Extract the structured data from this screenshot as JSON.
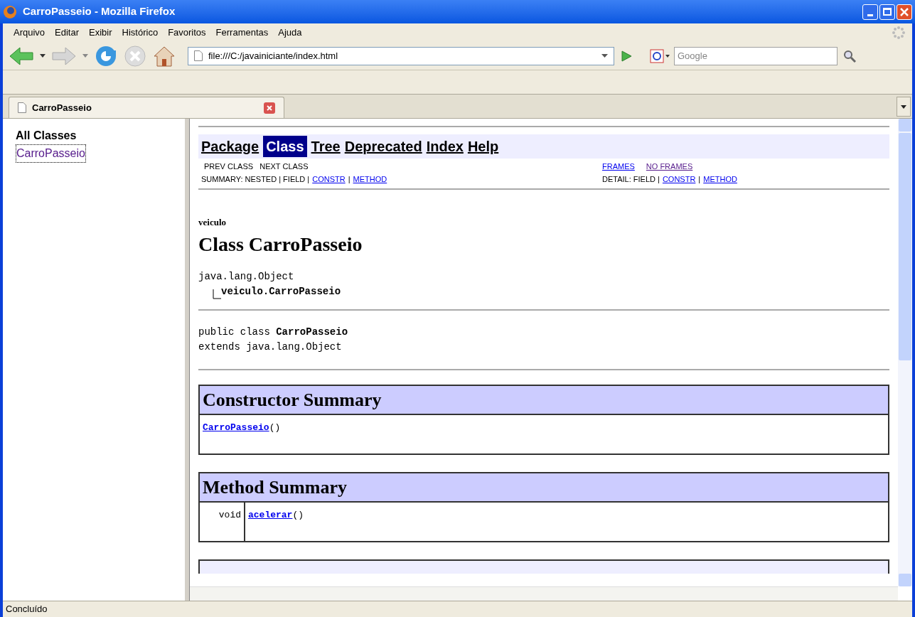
{
  "window": {
    "title": "CarroPasseio - Mozilla Firefox"
  },
  "menu": [
    "Arquivo",
    "Editar",
    "Exibir",
    "Histórico",
    "Favoritos",
    "Ferramentas",
    "Ajuda"
  ],
  "address": {
    "value": "file:///C:/javainiciante/index.html"
  },
  "search": {
    "placeholder": "Google"
  },
  "tabs": [
    {
      "label": "CarroPasseio",
      "selected": true
    }
  ],
  "left_frame": {
    "heading": "All Classes",
    "items": [
      {
        "label": "CarroPasseio",
        "visited": true
      }
    ]
  },
  "navbar": {
    "items": [
      {
        "label": "Package",
        "selected": false
      },
      {
        "label": "Class",
        "selected": true
      },
      {
        "label": "Tree",
        "selected": false
      },
      {
        "label": "Deprecated",
        "selected": false
      },
      {
        "label": "Index",
        "selected": false
      },
      {
        "label": "Help",
        "selected": false
      }
    ],
    "prev_next": "PREV CLASS   NEXT CLASS",
    "frames": [
      {
        "label": "FRAMES",
        "visited": false
      },
      {
        "label": "NO FRAMES",
        "visited": true
      }
    ],
    "summary": {
      "label": "SUMMARY: NESTED | FIELD |",
      "links": [
        "CONSTR",
        "METHOD"
      ],
      "separator": "|"
    },
    "detail": {
      "label": "DETAIL: FIELD |",
      "links": [
        "CONSTR",
        "METHOD"
      ],
      "separator": "|"
    }
  },
  "package": "veiculo",
  "class_title": "Class CarroPasseio",
  "hierarchy": [
    "java.lang.Object",
    "veiculo.CarroPasseio"
  ],
  "declaration": {
    "prefix": "public class ",
    "name": "CarroPasseio",
    "extends": "extends java.lang.Object"
  },
  "constructor_summary": {
    "title": "Constructor Summary",
    "rows": [
      {
        "name": "CarroPasseio",
        "args": "()"
      }
    ]
  },
  "method_summary": {
    "title": "Method Summary",
    "rows": [
      {
        "type": "void",
        "name": "acelerar",
        "args": "()"
      }
    ]
  },
  "status": "Concluído"
}
